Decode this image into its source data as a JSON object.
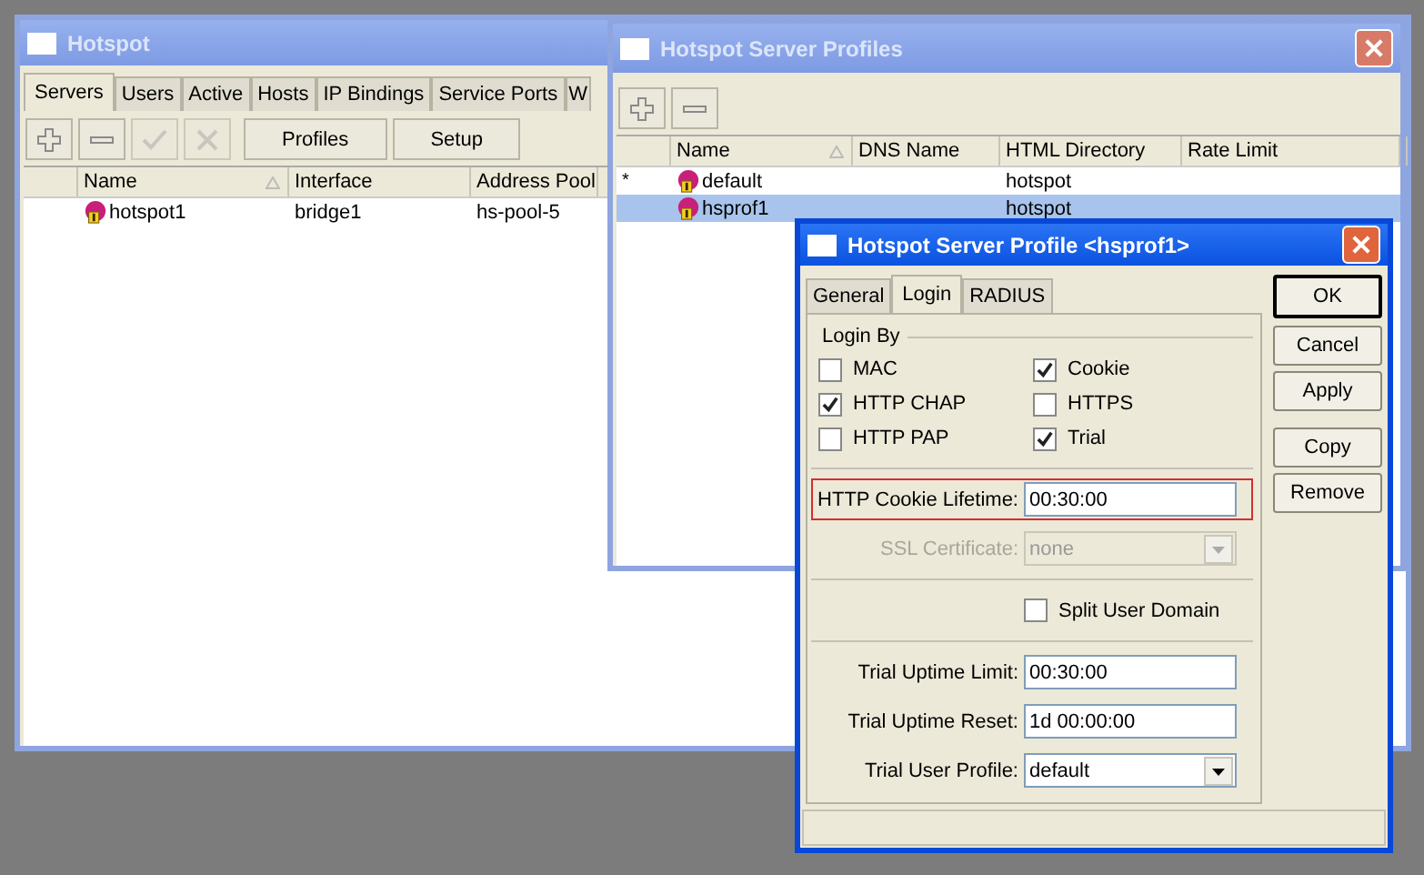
{
  "hotspot_window": {
    "title": "Hotspot",
    "tabs": [
      {
        "label": "Servers",
        "selected": true
      },
      {
        "label": "Users",
        "selected": false
      },
      {
        "label": "Active",
        "selected": false
      },
      {
        "label": "Hosts",
        "selected": false
      },
      {
        "label": "IP Bindings",
        "selected": false
      },
      {
        "label": "Service Ports",
        "selected": false
      },
      {
        "label": "W",
        "selected": false
      }
    ],
    "toolbar": [
      {
        "kind": "add",
        "disabled": false
      },
      {
        "kind": "remove",
        "disabled": false
      },
      {
        "kind": "enable",
        "disabled": true
      },
      {
        "kind": "disable",
        "disabled": true
      },
      {
        "kind": "text",
        "label": "Profiles"
      },
      {
        "kind": "text",
        "label": "Setup"
      }
    ],
    "table": {
      "columns": [
        "Name",
        "Interface",
        "Address Pool"
      ],
      "rows": [
        {
          "name": "hotspot1",
          "interface": "bridge1",
          "address_pool": "hs-pool-5",
          "selected": false
        }
      ]
    }
  },
  "profiles_window": {
    "title": "Hotspot Server Profiles",
    "toolbar": [
      {
        "kind": "add",
        "disabled": false
      },
      {
        "kind": "remove",
        "disabled": false
      }
    ],
    "table": {
      "columns": [
        "Name",
        "DNS Name",
        "HTML Directory",
        "Rate Limit"
      ],
      "rows": [
        {
          "flag": "*",
          "name": "default",
          "html_directory": "hotspot",
          "selected": false
        },
        {
          "name": "hsprof1",
          "html_directory": "hotspot",
          "selected": true
        }
      ]
    }
  },
  "profile_dialog": {
    "title": "Hotspot Server Profile <hsprof1>",
    "tabs": [
      {
        "label": "General",
        "selected": false
      },
      {
        "label": "Login",
        "selected": true
      },
      {
        "label": "RADIUS",
        "selected": false
      }
    ],
    "login_by": {
      "title": "Login By",
      "options": [
        {
          "label": "MAC",
          "checked": false
        },
        {
          "label": "Cookie",
          "checked": true
        },
        {
          "label": "HTTP CHAP",
          "checked": true
        },
        {
          "label": "HTTPS",
          "checked": false
        },
        {
          "label": "HTTP PAP",
          "checked": false
        },
        {
          "label": "Trial",
          "checked": true
        }
      ]
    },
    "field_groups": [
      [
        {
          "kind": "text",
          "label": "HTTP Cookie Lifetime:",
          "value": "00:30:00",
          "highlighted": true,
          "disabled": false
        },
        {
          "kind": "dropdown",
          "label": "SSL Certificate:",
          "value": "none",
          "highlighted": false,
          "disabled": true
        }
      ],
      [
        {
          "kind": "checkbox",
          "label": "Split User Domain",
          "checked": false
        }
      ],
      [
        {
          "kind": "text",
          "label": "Trial Uptime Limit:",
          "value": "00:30:00",
          "highlighted": false,
          "disabled": false
        },
        {
          "kind": "text",
          "label": "Trial Uptime Reset:",
          "value": "1d 00:00:00",
          "highlighted": false,
          "disabled": false
        },
        {
          "kind": "dropdown",
          "label": "Trial User Profile:",
          "value": "default",
          "highlighted": false,
          "disabled": false
        }
      ]
    ],
    "button_groups": [
      [
        {
          "label": "OK",
          "default": true
        },
        {
          "label": "Cancel",
          "default": false
        },
        {
          "label": "Apply",
          "default": false
        }
      ],
      [
        {
          "label": "Copy",
          "default": false
        },
        {
          "label": "Remove",
          "default": false
        }
      ]
    ]
  }
}
